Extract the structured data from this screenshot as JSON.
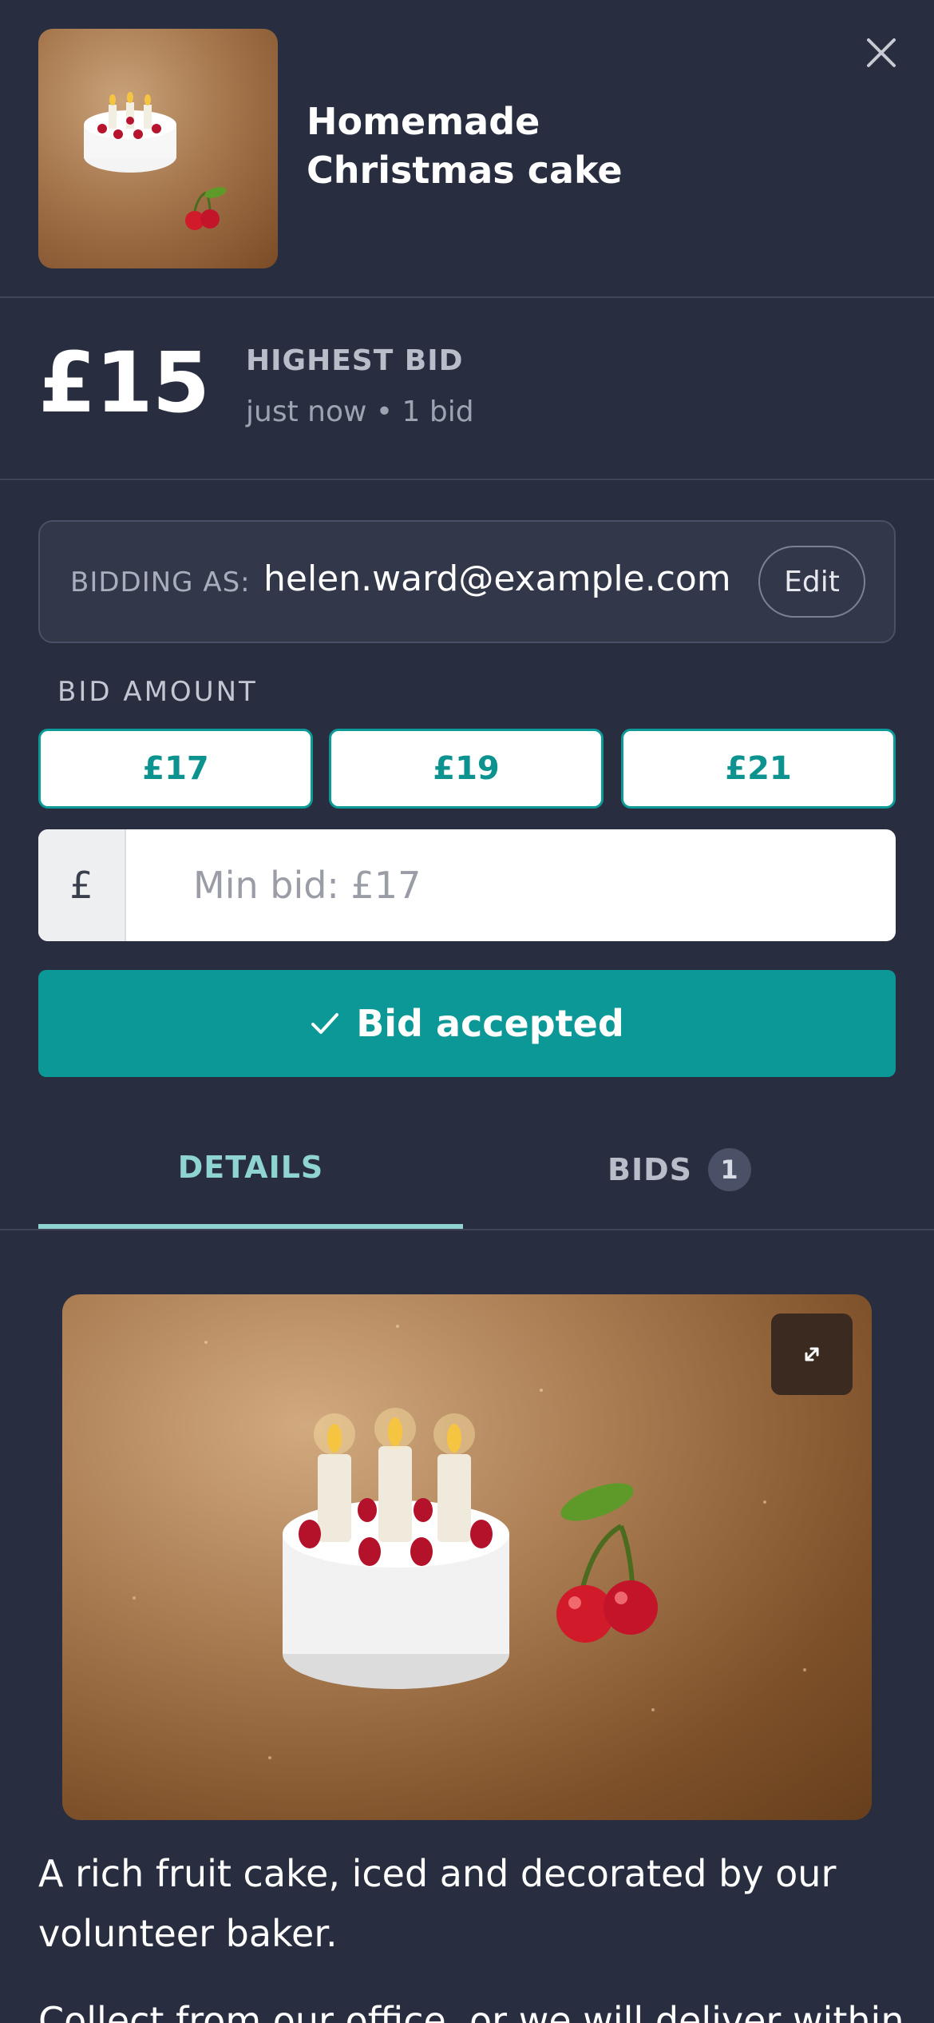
{
  "item": {
    "title": "Homemade Christmas cake"
  },
  "bid_summary": {
    "price": "£15",
    "label": "HIGHEST BID",
    "meta": "just now • 1 bid"
  },
  "bidder": {
    "label": "BIDDING AS:",
    "email": "helen.ward@example.com",
    "edit_label": "Edit"
  },
  "bid_form": {
    "amount_label": "BID AMOUNT",
    "quick_bids": [
      "£17",
      "£19",
      "£21"
    ],
    "currency_symbol": "£",
    "placeholder": "Min bid: £17",
    "submit_label": "Bid accepted"
  },
  "tabs": {
    "details": "DETAILS",
    "bids": "BIDS",
    "bids_count": "1"
  },
  "description": {
    "p1": "A rich fruit cake, iced and decorated by our volunteer baker.",
    "p2": "Collect from our office, or we will deliver within"
  },
  "colors": {
    "background": "#282e40",
    "accent": "#0c9896",
    "tab_active": "#8fd3d3"
  },
  "icons": [
    "close-icon",
    "check-icon",
    "expand-icon"
  ]
}
